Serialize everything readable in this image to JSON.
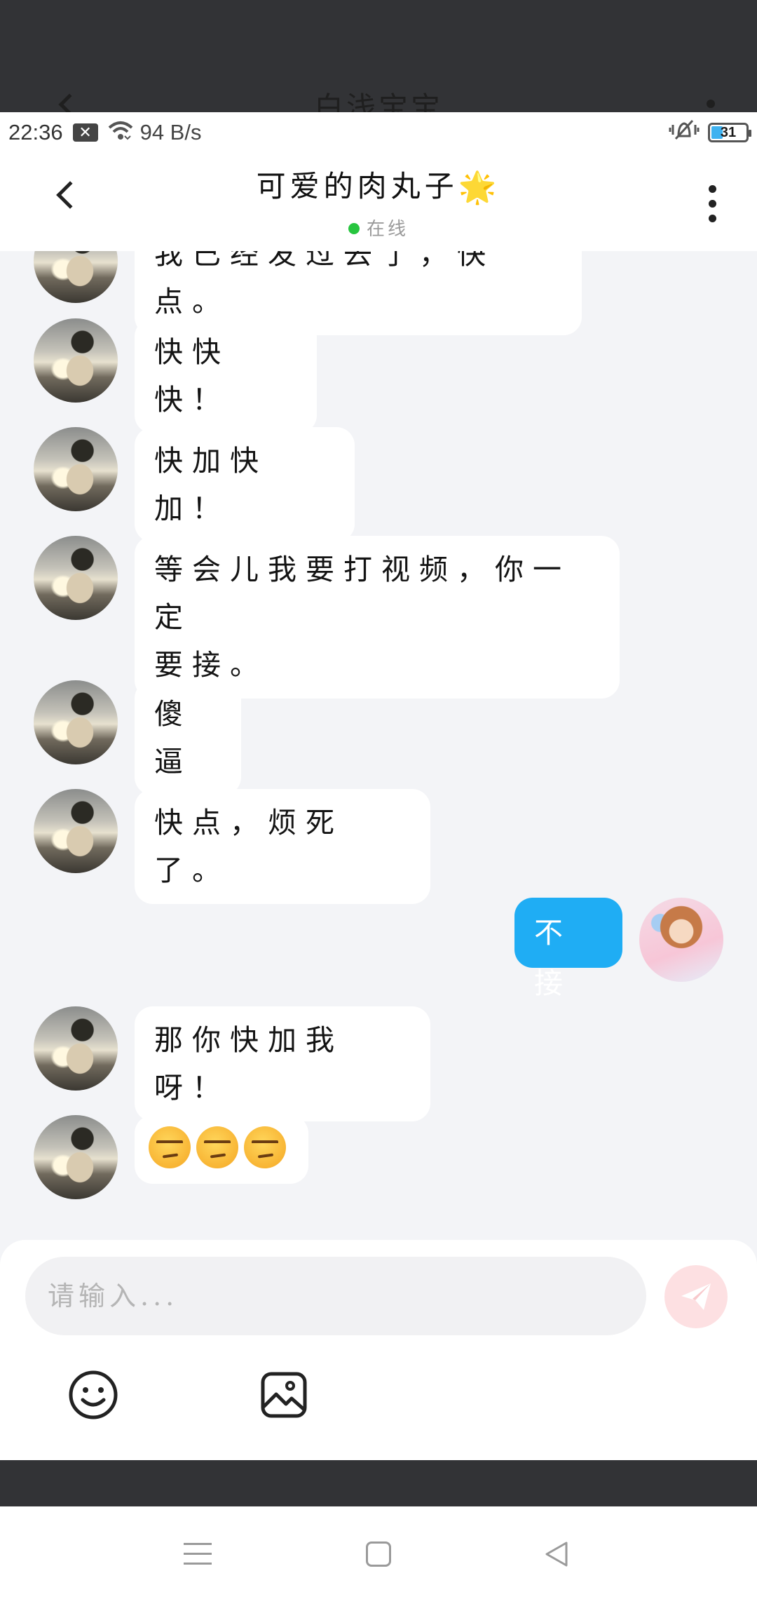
{
  "background_window": {
    "title": "白浅宝宝"
  },
  "status_bar": {
    "time": "22:36",
    "network_speed": "94 B/s",
    "battery_level": "31"
  },
  "header": {
    "contact_name": "可爱的肉丸子",
    "status": "在线"
  },
  "messages": [
    {
      "side": "left",
      "text": "我已经发过去了，快点。"
    },
    {
      "side": "left",
      "text": "快快快！"
    },
    {
      "side": "left",
      "text": "快加快加！"
    },
    {
      "side": "left",
      "line1": "等会儿我要打视频，你一定",
      "line2": "要接。"
    },
    {
      "side": "left",
      "text": "傻逼"
    },
    {
      "side": "left",
      "text": "快点，烦死了。"
    },
    {
      "side": "right",
      "text": "不接"
    },
    {
      "side": "left",
      "text": "那你快加我呀！"
    },
    {
      "side": "left",
      "emoji": [
        "unamused-face",
        "unamused-face",
        "unamused-face"
      ]
    }
  ],
  "composer": {
    "placeholder": "请输入..."
  },
  "colors": {
    "accent_blue": "#1fadf4",
    "online_green": "#27c53f",
    "send_button_bg": "#fde0e2",
    "chat_background": "#f3f4f7"
  }
}
